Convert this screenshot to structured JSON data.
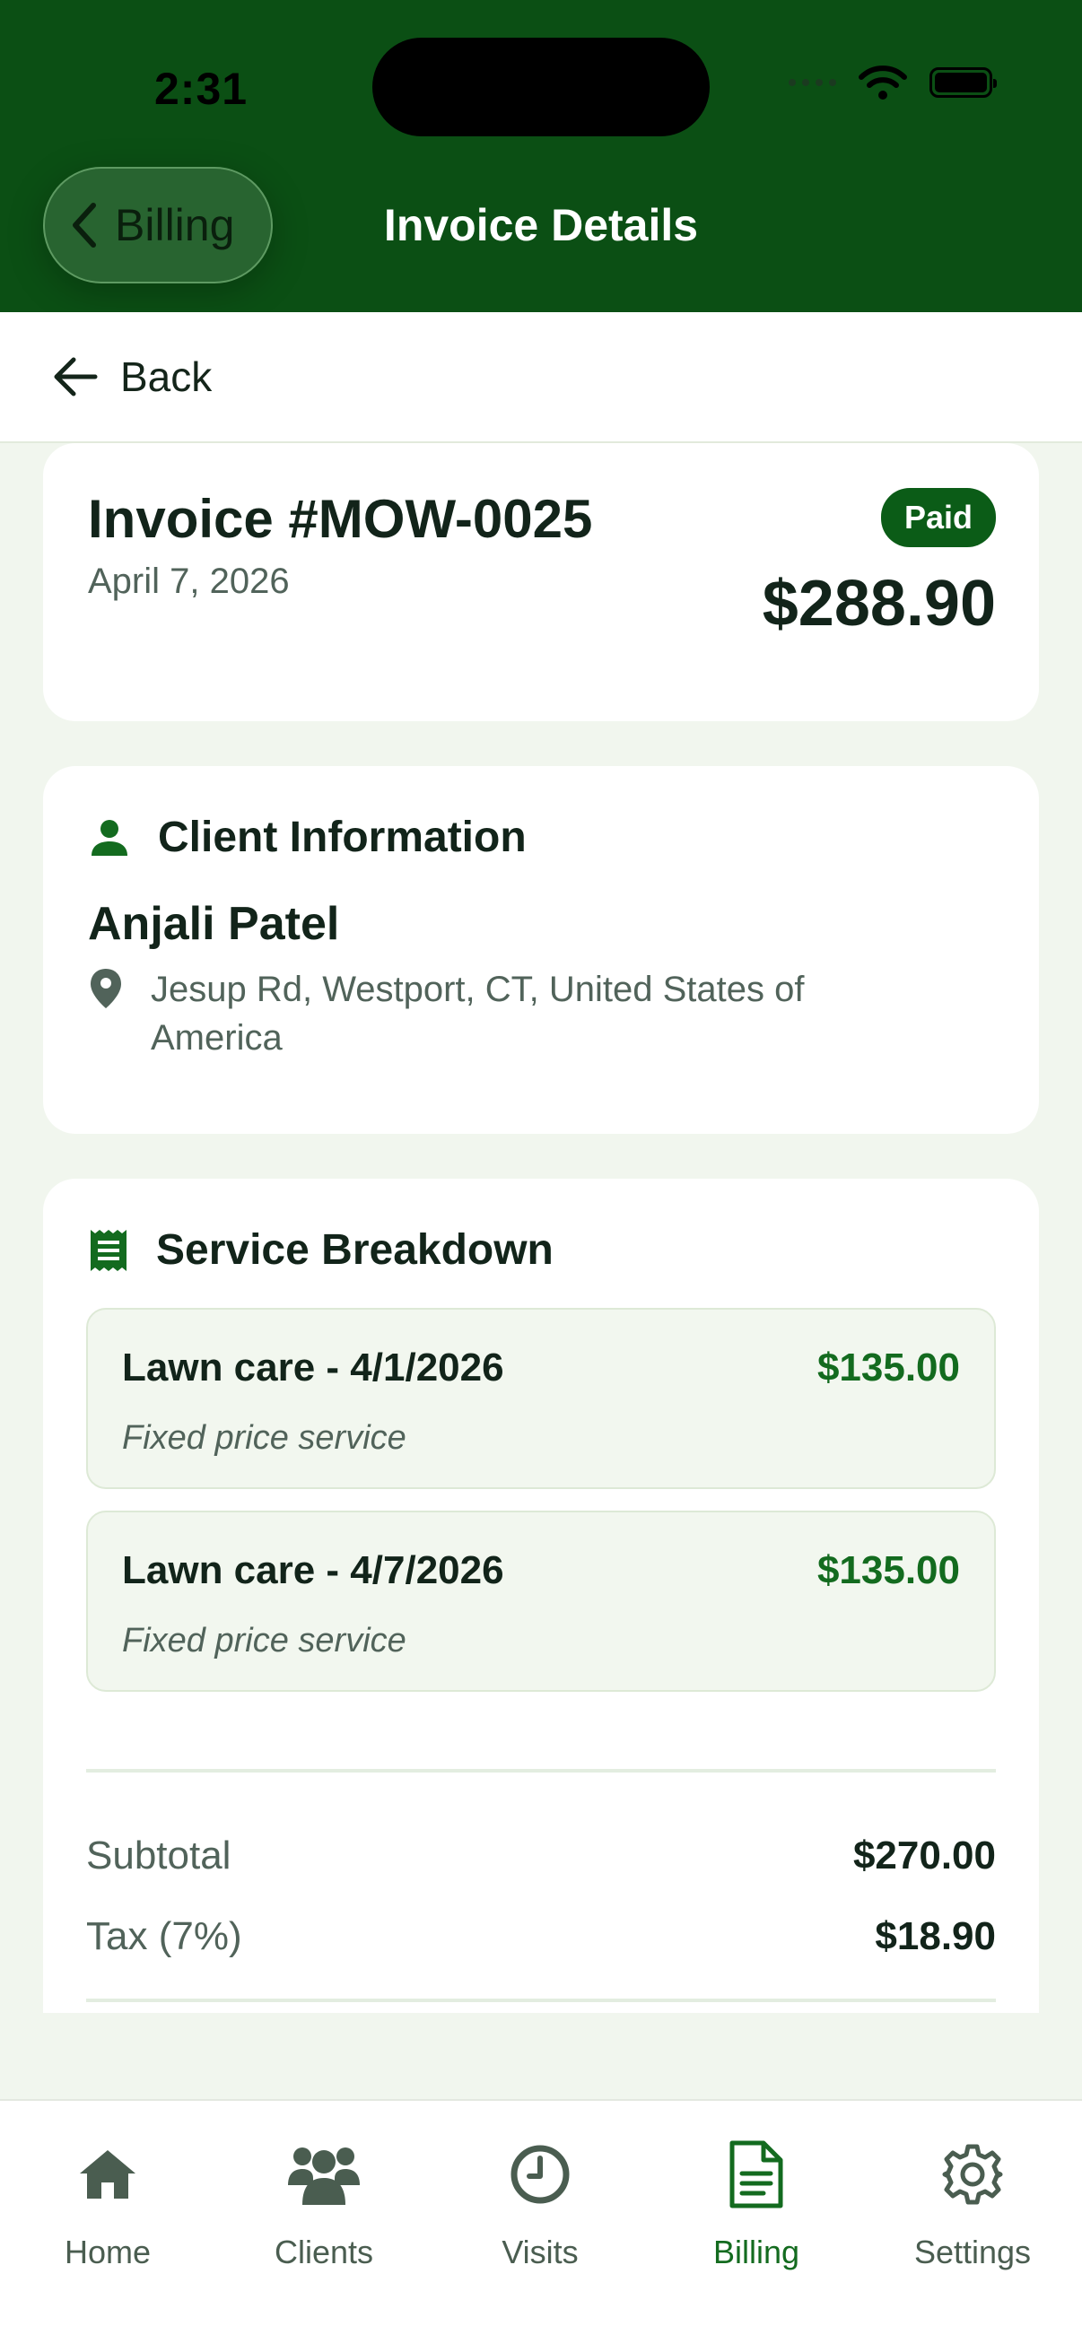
{
  "status_bar": {
    "time": "2:31"
  },
  "nav": {
    "back_label": "Billing",
    "title": "Invoice Details"
  },
  "back_row": {
    "label": "Back"
  },
  "invoice": {
    "number": "Invoice #MOW-0025",
    "date": "April 7, 2026",
    "status": "Paid",
    "total": "$288.90"
  },
  "client": {
    "section_title": "Client Information",
    "name": "Anjali Patel",
    "address": "Jesup Rd, Westport, CT, United States of America"
  },
  "services": {
    "section_title": "Service Breakdown",
    "items": [
      {
        "name": "Lawn care - 4/1/2026",
        "price": "$135.00",
        "description": "Fixed price service"
      },
      {
        "name": "Lawn care - 4/7/2026",
        "price": "$135.00",
        "description": "Fixed price service"
      }
    ],
    "subtotal_label": "Subtotal",
    "subtotal_value": "$270.00",
    "tax_label": "Tax (7%)",
    "tax_value": "$18.90"
  },
  "tabbar": {
    "items": [
      {
        "label": "Home",
        "icon": "home-icon"
      },
      {
        "label": "Clients",
        "icon": "users-icon"
      },
      {
        "label": "Visits",
        "icon": "clock-icon"
      },
      {
        "label": "Billing",
        "icon": "document-icon",
        "active": true
      },
      {
        "label": "Settings",
        "icon": "gear-icon"
      }
    ]
  },
  "colors": {
    "brand_dark": "#0b4f14",
    "accent": "#136b1f",
    "background": "#f1f6ee"
  }
}
